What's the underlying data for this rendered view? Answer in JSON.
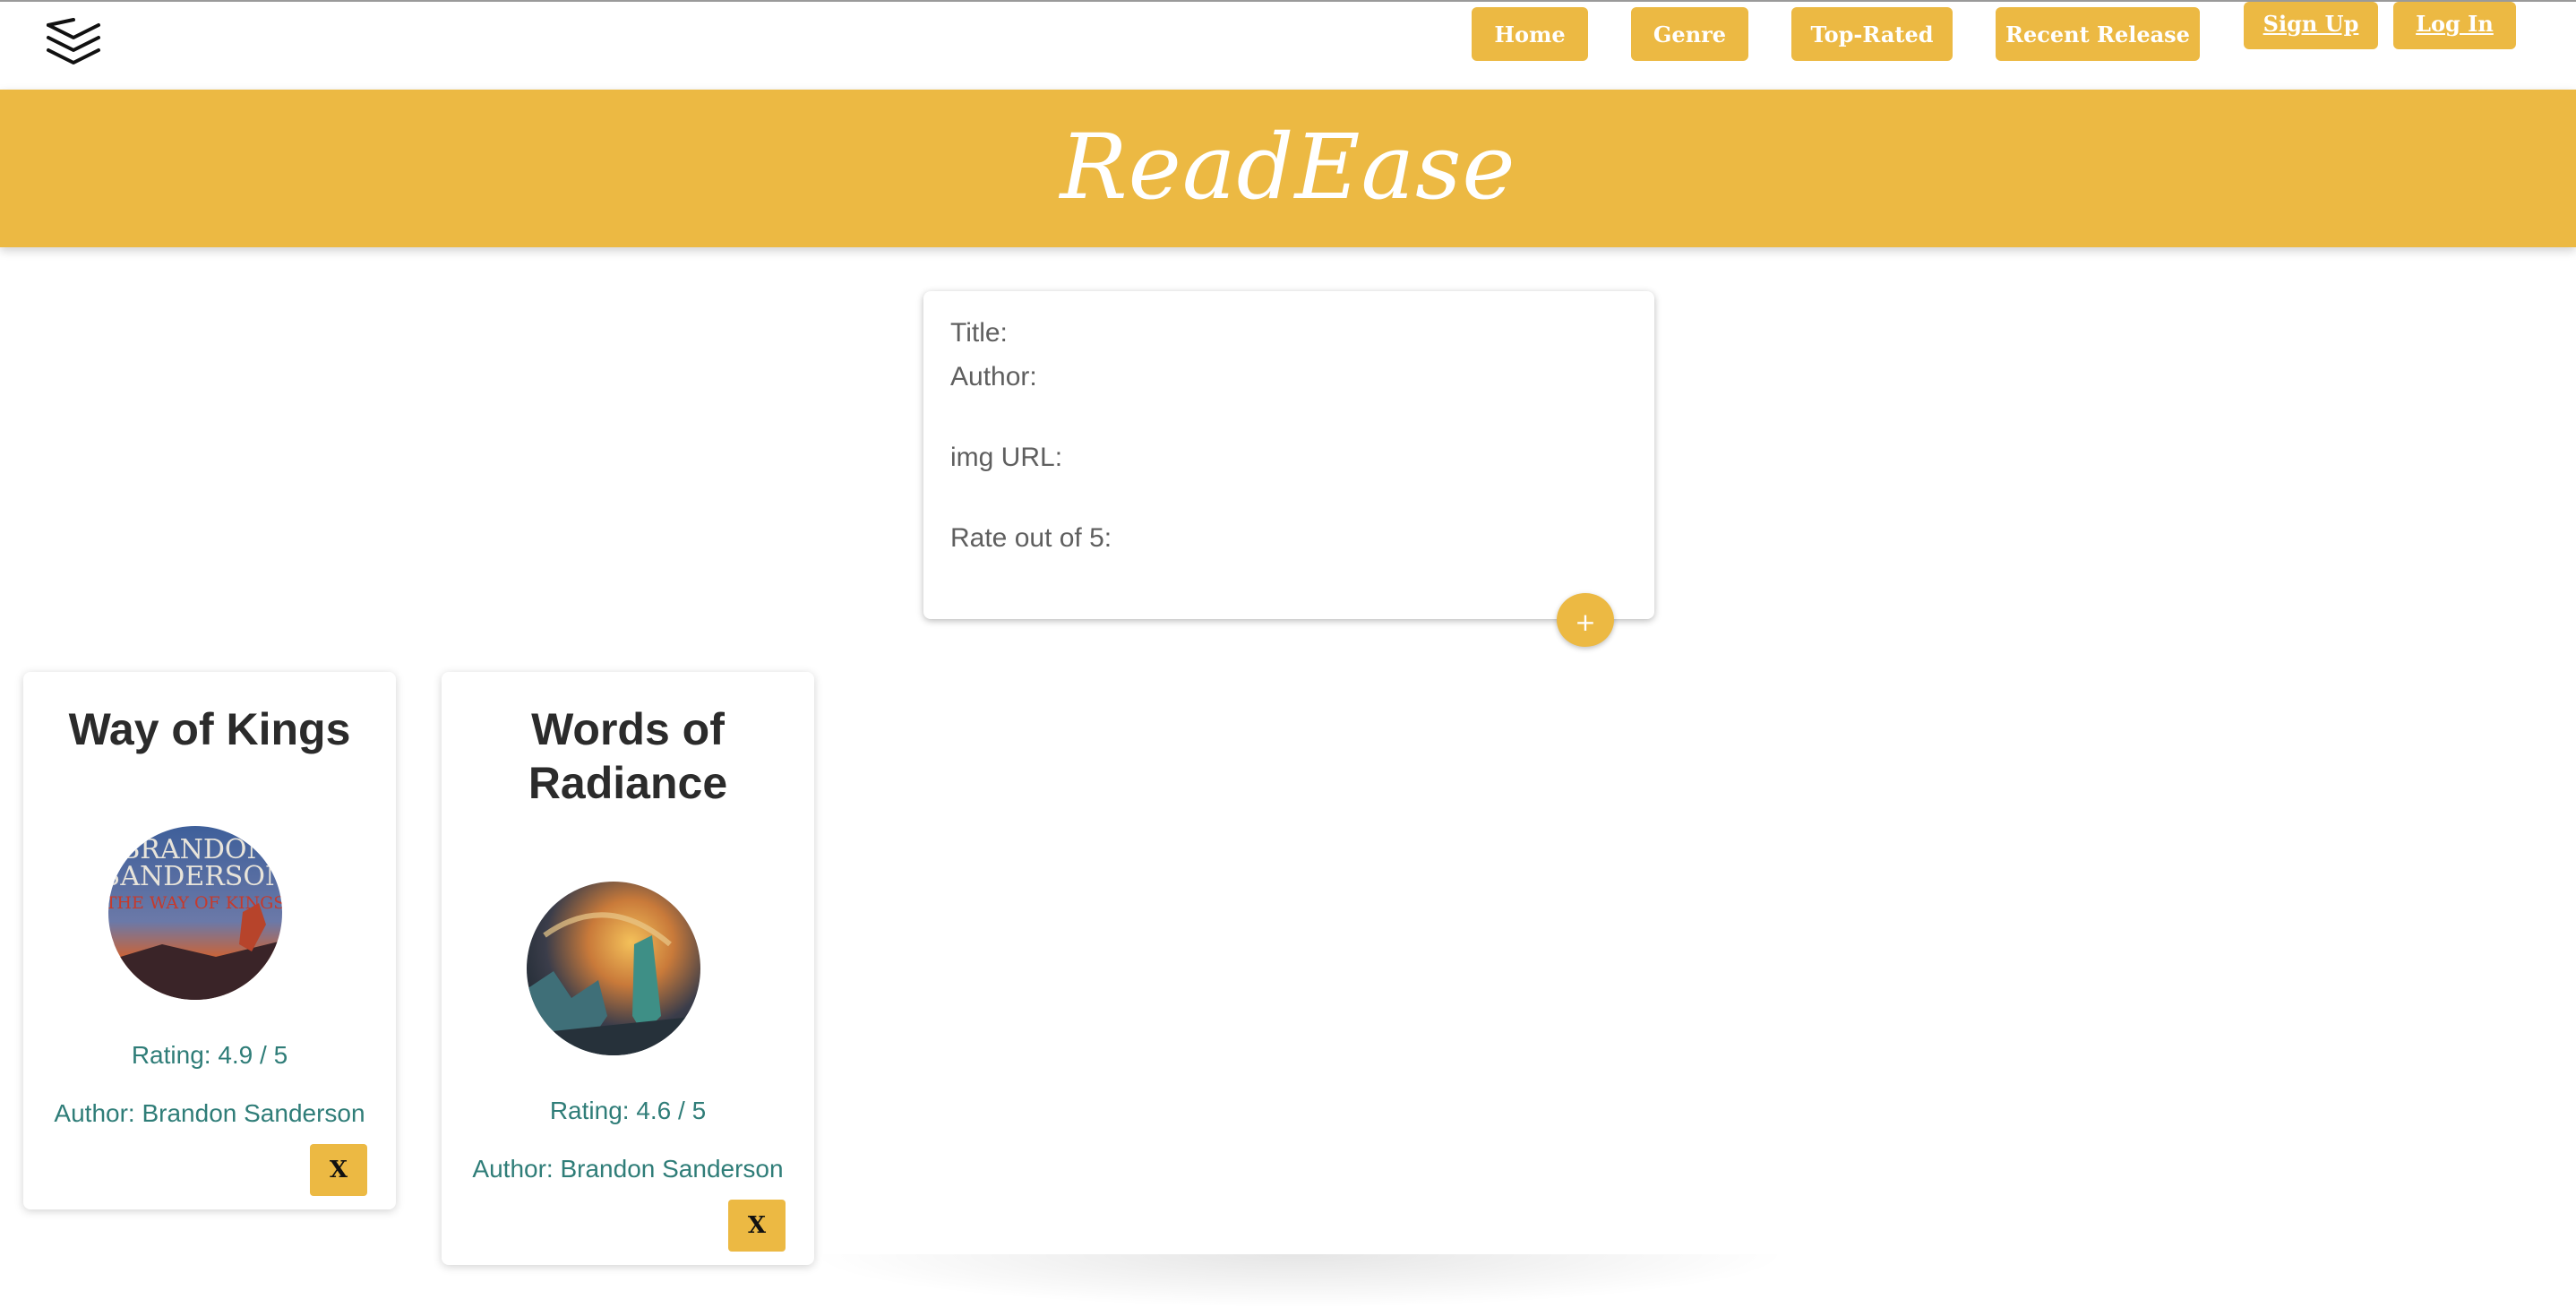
{
  "header": {
    "menu_icon": "stacked-chevrons-icon",
    "nav": [
      "Home",
      "Genre",
      "Top-Rated",
      "Recent Release"
    ],
    "auth": [
      "Sign Up",
      "Log In"
    ]
  },
  "banner": {
    "brand": "ReadEase"
  },
  "form": {
    "title_label": "Title:",
    "author_label": "Author:",
    "img_label": "img URL:",
    "rate_label": "Rate out of 5:",
    "add_label": "+"
  },
  "books": [
    {
      "title": "Way of Kings",
      "rating": "Rating: 4.9 / 5",
      "author": "Author: Brandon Sanderson",
      "cover_text": [
        "BRANDON",
        "SANDERSON",
        "THE WAY OF KINGS"
      ],
      "delete_label": "X"
    },
    {
      "title_lines": [
        "Words of",
        "Radiance"
      ],
      "rating": "Rating: 4.6 / 5",
      "author": "Author: Brandon Sanderson",
      "delete_label": "X"
    }
  ],
  "colors": {
    "accent": "#ecb943",
    "meta_text": "#2f7d78"
  }
}
